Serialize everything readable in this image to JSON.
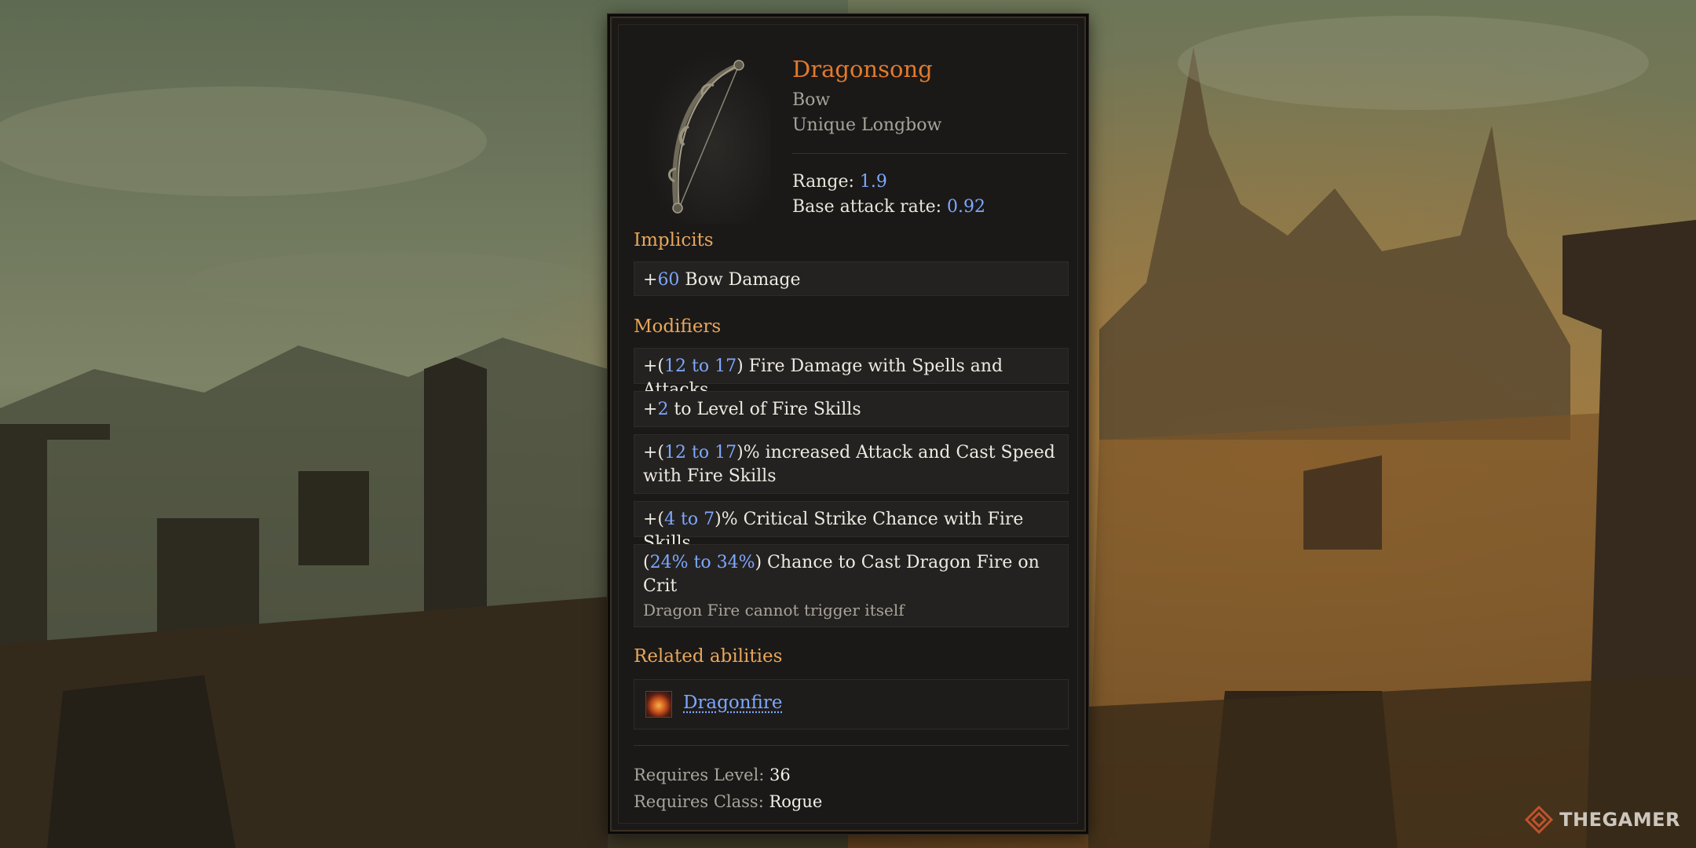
{
  "item": {
    "name": "Dragonsong",
    "type": "Bow",
    "subtype": "Unique Longbow",
    "icon": "longbow-icon",
    "stats": [
      {
        "label": "Range: ",
        "value": "1.9"
      },
      {
        "label": "Base attack rate: ",
        "value": "0.92"
      }
    ]
  },
  "implicits": {
    "heading": "Implicits",
    "items": [
      {
        "plus": "+",
        "value": "60",
        "text": " Bow Damage"
      }
    ]
  },
  "modifiers": {
    "heading": "Modifiers",
    "m1": {
      "prefix": "+(",
      "min": "12",
      "to": " to ",
      "max": "17",
      "suffix": ") Fire Damage with Spells and Attacks"
    },
    "m2": {
      "prefix": "+",
      "value": "2",
      "suffix": " to Level of Fire Skills"
    },
    "m3": {
      "prefix": "+(",
      "min": "12",
      "to": " to ",
      "max": "17",
      "suffix": ")% increased Attack and Cast Speed with Fire Skills"
    },
    "m4": {
      "prefix": "+(",
      "min": "4",
      "to": " to ",
      "max": "7",
      "suffix": ")% Critical Strike Chance with Fire Skills"
    },
    "m5": {
      "prefix": "(",
      "min": "24%",
      "to": " to ",
      "max": "34%",
      "suffix": ") Chance to Cast Dragon Fire on Crit",
      "note": "Dragon Fire cannot trigger itself"
    }
  },
  "related": {
    "heading": "Related abilities",
    "ability": {
      "name": "Dragonfire",
      "icon": "dragonfire-ability-icon"
    }
  },
  "requirements": {
    "level_label": "Requires Level: ",
    "level": "36",
    "class_label": "Requires Class: ",
    "class": "Rogue"
  },
  "watermark": {
    "text": "THEGAMER",
    "icon": "thegamer-logo-icon"
  },
  "colors": {
    "item_name": "#e47a2c",
    "section_heading": "#e9a65a",
    "value_blue": "#7ea7ff",
    "panel_bg": "#1a1918"
  }
}
